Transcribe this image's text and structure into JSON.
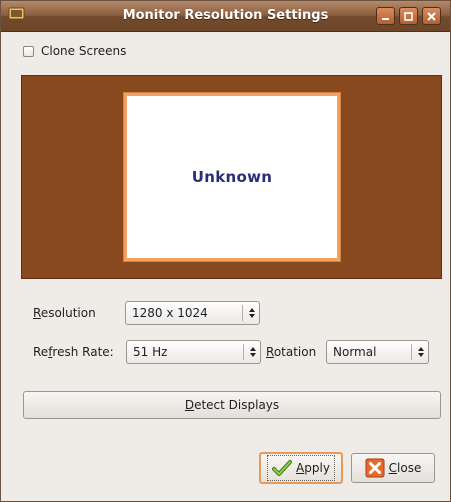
{
  "window": {
    "title": "Monitor Resolution Settings"
  },
  "clone_screens": {
    "label": "Clone Screens",
    "checked": false
  },
  "preview": {
    "monitor_label": "Unknown",
    "background_color": "#87491d",
    "monitor_border_color": "#f3a060"
  },
  "resolution": {
    "label_prefix": "",
    "label_mnemonic": "R",
    "label_rest": "esolution",
    "value": "1280 x 1024"
  },
  "refresh_rate": {
    "label_prefix": "Re",
    "label_mnemonic": "f",
    "label_rest": "resh Rate:",
    "value": "51 Hz"
  },
  "rotation": {
    "label_prefix": "",
    "label_mnemonic": "R",
    "label_rest": "otation",
    "value": "Normal"
  },
  "detect_button": {
    "label_prefix": "",
    "label_mnemonic": "D",
    "label_rest": "etect Displays"
  },
  "apply_button": {
    "label_prefix": "",
    "label_mnemonic": "A",
    "label_rest": "pply",
    "icon": "checkmark-icon"
  },
  "close_button": {
    "label_prefix": "",
    "label_mnemonic": "C",
    "label_rest": "lose",
    "icon": "close-x-icon"
  }
}
